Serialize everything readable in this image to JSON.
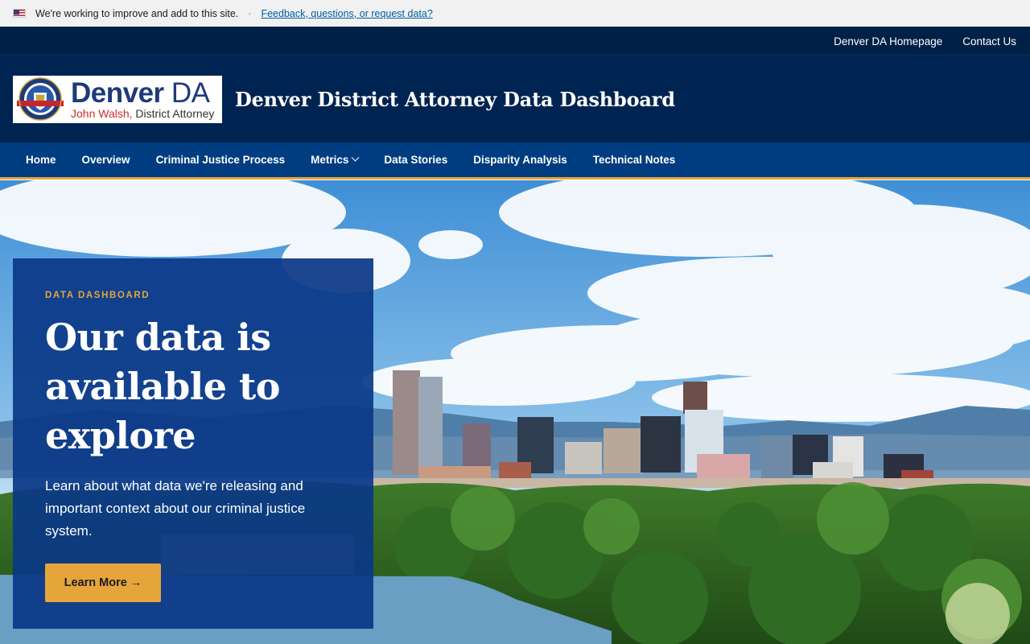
{
  "gov_banner": {
    "message": "We're working to improve and add to this site.",
    "separator": "·",
    "link": "Feedback, questions, or request data?"
  },
  "utility_nav": {
    "items": [
      "Denver DA Homepage",
      "Contact Us"
    ]
  },
  "header": {
    "logo_main": "Denver",
    "logo_da": "DA",
    "logo_name": "John Walsh,",
    "logo_role": "District Attorney",
    "site_title": "Denver District Attorney Data Dashboard"
  },
  "nav": {
    "items": [
      {
        "label": "Home"
      },
      {
        "label": "Overview"
      },
      {
        "label": "Criminal Justice Process"
      },
      {
        "label": "Metrics",
        "icon": "chevron-down-icon"
      },
      {
        "label": "Data Stories"
      },
      {
        "label": "Disparity Analysis"
      },
      {
        "label": "Technical Notes"
      }
    ]
  },
  "hero": {
    "eyebrow": "DATA DASHBOARD",
    "heading_line1": "Our data is",
    "heading_line2": "available to",
    "heading_line3": "explore",
    "text": "Learn about what data we're releasing and important context about our criminal justice system.",
    "cta_label": "Learn More →"
  },
  "colors": {
    "gov_banner_bg": "#f1f1f2",
    "utility_bg": "#002147",
    "header_bg": "#002451",
    "nav_bg": "#003d80",
    "accent": "#e5a53a",
    "card_bg": "#0a3787"
  }
}
